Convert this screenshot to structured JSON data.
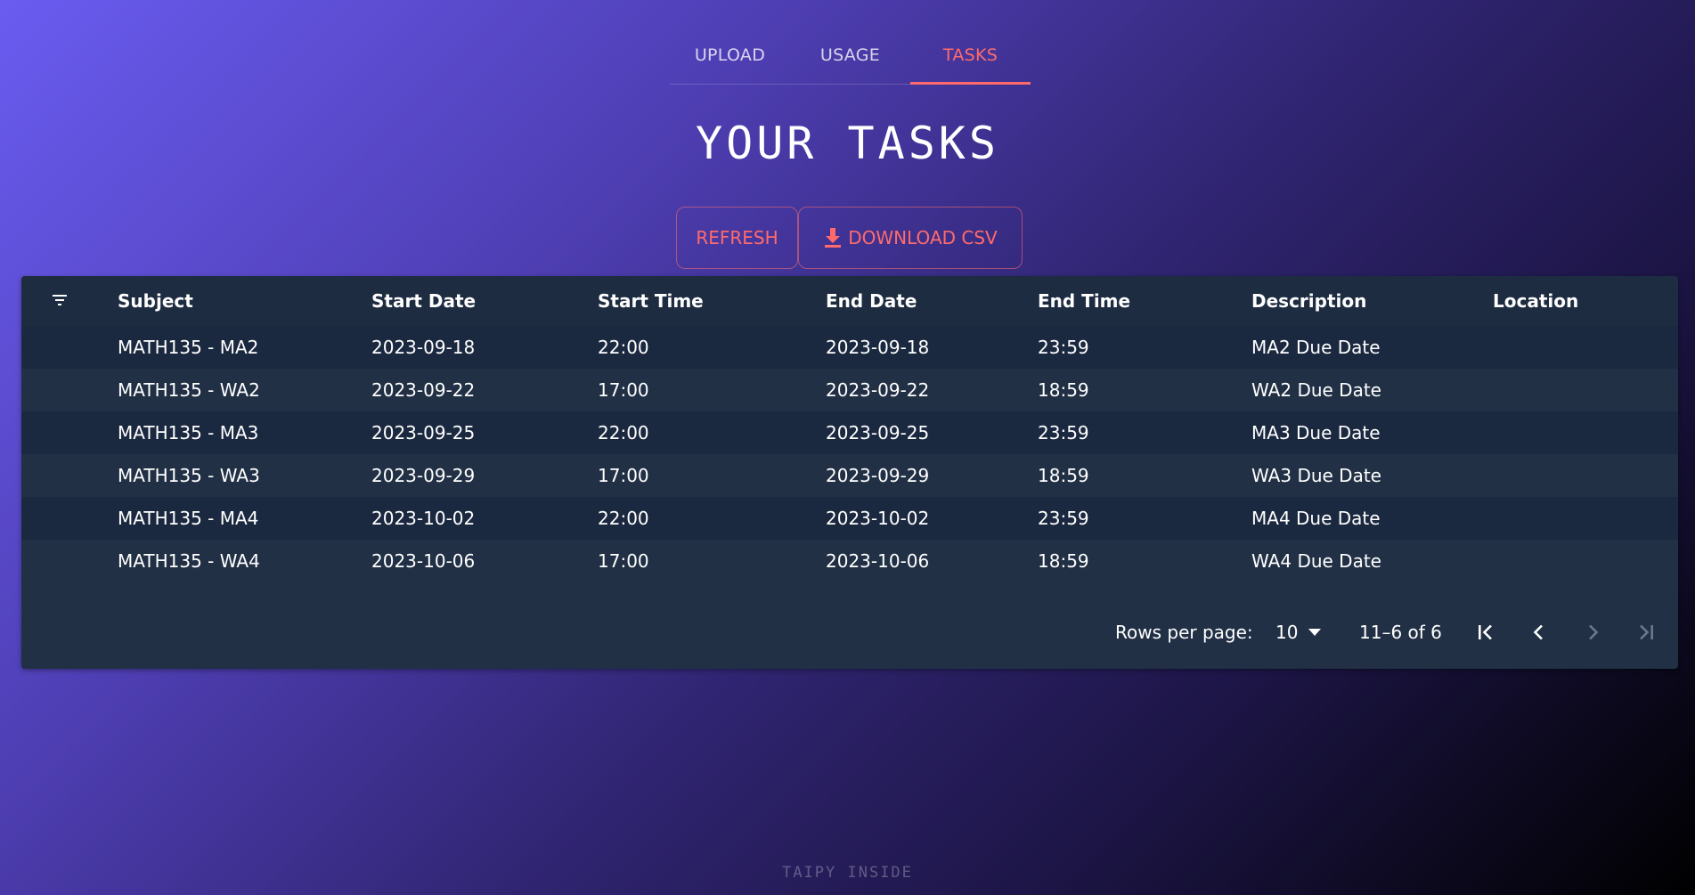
{
  "tabs": [
    {
      "label": "UPLOAD",
      "active": false
    },
    {
      "label": "USAGE",
      "active": false
    },
    {
      "label": "TASKS",
      "active": true
    }
  ],
  "page_title": "YOUR TASKS",
  "actions": {
    "refresh_label": "REFRESH",
    "download_label": "DOWNLOAD CSV",
    "download_icon": "download-icon"
  },
  "table": {
    "filter_icon": "filter-icon",
    "columns": [
      "Subject",
      "Start Date",
      "Start Time",
      "End Date",
      "End Time",
      "Description",
      "Location"
    ],
    "rows": [
      [
        "MATH135 - MA2",
        "2023-09-18",
        "22:00",
        "2023-09-18",
        "23:59",
        "MA2 Due Date",
        ""
      ],
      [
        "MATH135 - WA2",
        "2023-09-22",
        "17:00",
        "2023-09-22",
        "18:59",
        "WA2 Due Date",
        ""
      ],
      [
        "MATH135 - MA3",
        "2023-09-25",
        "22:00",
        "2023-09-25",
        "23:59",
        "MA3 Due Date",
        ""
      ],
      [
        "MATH135 - WA3",
        "2023-09-29",
        "17:00",
        "2023-09-29",
        "18:59",
        "WA3 Due Date",
        ""
      ],
      [
        "MATH135 - MA4",
        "2023-10-02",
        "22:00",
        "2023-10-02",
        "23:59",
        "MA4 Due Date",
        ""
      ],
      [
        "MATH135 - WA4",
        "2023-10-06",
        "17:00",
        "2023-10-06",
        "18:59",
        "WA4 Due Date",
        ""
      ]
    ]
  },
  "pagination": {
    "rows_per_page_label": "Rows per page:",
    "rows_per_page_value": "10",
    "range_text": "11–6 of 6",
    "first_page_icon": "first-page-icon",
    "prev_page_icon": "chevron-left-icon",
    "next_page_icon": "chevron-right-icon",
    "last_page_icon": "last-page-icon"
  },
  "footer_text": "TAIPY INSIDE",
  "colors": {
    "accent": "#ff6b6b",
    "table_bg": "#213045",
    "row_alt": "#1b2940",
    "disabled": "#6d7889"
  }
}
